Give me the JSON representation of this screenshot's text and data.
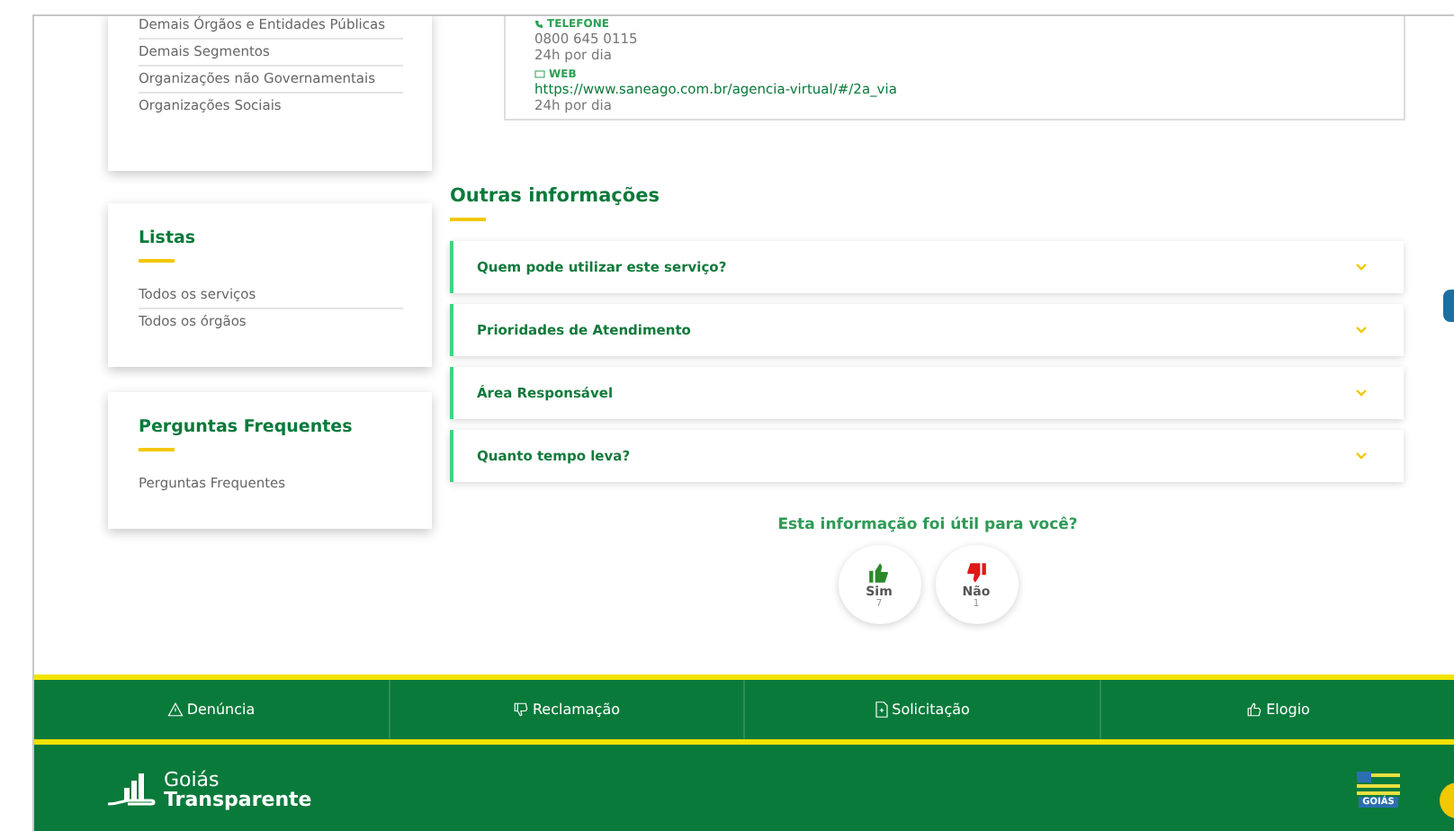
{
  "segments": {
    "items": [
      "Demais Órgãos e Entidades Públicas",
      "Demais Segmentos",
      "Organizações não Governamentais",
      "Organizações Sociais"
    ]
  },
  "contact": [
    {
      "kind": "phone",
      "label": "TELEFONE",
      "value": "0800 645 0115",
      "hours": "24h por dia"
    },
    {
      "kind": "web",
      "label": "WEB",
      "value": "https://www.saneago.com.br/agencia-virtual/#/2a_via",
      "hours": "24h por dia"
    }
  ],
  "lists": {
    "title": "Listas",
    "items": [
      "Todos os serviços",
      "Todos os órgãos"
    ]
  },
  "faq": {
    "title": "Perguntas Frequentes",
    "items": [
      "Perguntas Frequentes"
    ]
  },
  "other_info": {
    "title": "Outras informações",
    "items": [
      {
        "label": "Quem pode utilizar este serviço?",
        "expanded": false
      },
      {
        "label": "Prioridades de Atendimento",
        "expanded": false
      },
      {
        "label": "Área Responsável",
        "expanded": false
      },
      {
        "label": "Quanto tempo leva?",
        "expanded": false
      }
    ]
  },
  "feedback": {
    "question": "Esta informação foi útil para você?",
    "options": [
      {
        "kind": "yes",
        "label": "Sim",
        "count": "7"
      },
      {
        "kind": "no",
        "label": "Não",
        "count": "1"
      }
    ]
  },
  "footer_tabs": [
    {
      "kind": "warning",
      "label": "Denúncia"
    },
    {
      "kind": "complaint",
      "label": "Reclamação"
    },
    {
      "kind": "request",
      "label": "Solicitação"
    },
    {
      "kind": "praise",
      "label": "Elogio"
    }
  ],
  "footer": {
    "brand_top": "Goiás",
    "brand_bottom": "Transparente",
    "state_logo": "GOIÁS"
  }
}
